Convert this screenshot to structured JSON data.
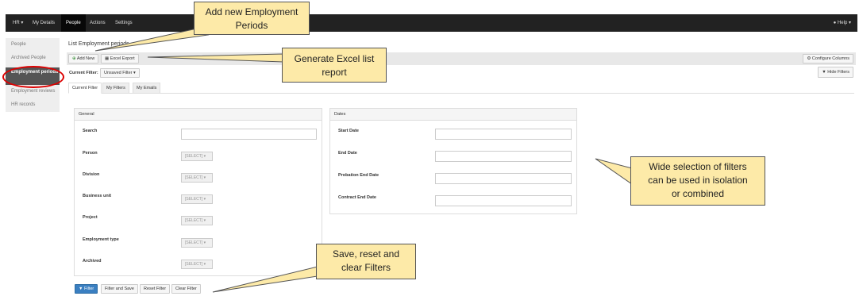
{
  "topnav": {
    "hr": "HR ▾",
    "my_details": "My Details",
    "people": "People",
    "actions": "Actions",
    "settings": "Settings",
    "help": "Help ▾"
  },
  "sidebar": {
    "items": [
      {
        "label": "People"
      },
      {
        "label": "Archived People"
      },
      {
        "label": "Employment periods"
      },
      {
        "label": "Employment reviews"
      },
      {
        "label": "HR records"
      }
    ]
  },
  "page": {
    "title": "List Employment periods"
  },
  "toolbar": {
    "add_new": "Add New",
    "excel_export": "Excel Export",
    "configure_columns": "Configure Columns",
    "hide_filters": "Hide Filters",
    "current_filter_label": "Current Filter:",
    "current_filter_value": "Unsaved Filter"
  },
  "tabs": [
    {
      "label": "Current Filter"
    },
    {
      "label": "My Filters"
    },
    {
      "label": "My Emails"
    }
  ],
  "general_panel": {
    "title": "General",
    "fields": [
      {
        "label": "Search"
      },
      {
        "label": "Person",
        "select": "[SELECT] ▾"
      },
      {
        "label": "Division",
        "select": "[SELECT] ▾"
      },
      {
        "label": "Business unit",
        "select": "[SELECT] ▾"
      },
      {
        "label": "Project",
        "select": "[SELECT] ▾"
      },
      {
        "label": "Employment type",
        "select": "[SELECT] ▾"
      },
      {
        "label": "Archived",
        "select": "[SELECT] ▾"
      }
    ]
  },
  "dates_panel": {
    "title": "Dates",
    "fields": [
      {
        "label": "Start Date"
      },
      {
        "label": "End Date"
      },
      {
        "label": "Probation End Date"
      },
      {
        "label": "Contract End Date"
      }
    ]
  },
  "footer": {
    "filter": "Filter",
    "filter_and_save": "Filter and Save",
    "reset_filter": "Reset Filter",
    "clear_filter": "Clear Filter"
  },
  "callouts": {
    "add_new": "Add new Employment Periods",
    "excel": "Generate Excel list report",
    "filters": "Wide selection of filters can be used in isolation or combined",
    "save": "Save, reset and clear Filters"
  },
  "colors": {
    "callout_bg": "#fdeaa8",
    "nav_bg": "#222222",
    "primary": "#3a7fc1",
    "highlight": "#dd0000"
  }
}
